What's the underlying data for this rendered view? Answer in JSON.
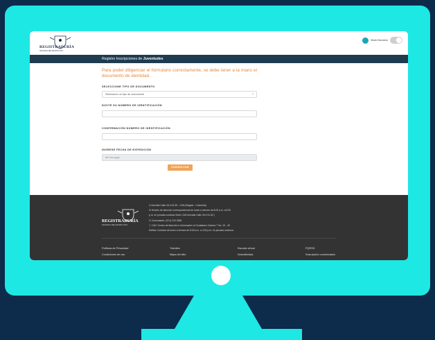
{
  "header": {
    "brand": "REGISTRADURÍA",
    "brand_sub": "NACIONAL DEL ESTADO CIVIL",
    "night_mode_label": "Modo Nocturno"
  },
  "title_bar": {
    "prefix": "Registro Inscripciones de ",
    "emphasis": "Juventudes"
  },
  "form": {
    "intro": "Para poder diligenciar el formulario correctamente, se debe tener a la mano el documento de identidad.",
    "doc_type_label": "SELECCIONE TIPO DE DOCUMENTO",
    "doc_type_value": "Seleccione un tipo de documento",
    "id_label": "DIGITE SU NÚMERO DE IDENTIFICACIÓN",
    "id_value": "",
    "confirm_label": "CONFIRMACIÓN NÚMERO DE IDENTIFICACIÓN",
    "confirm_value": "",
    "date_label": "INGRESE FECHA DE EXPEDICIÓN",
    "date_placeholder": "dd-mm-yyyy",
    "submit_label": "CONSULTAR"
  },
  "footer": {
    "brand": "REGISTRADURÍA",
    "brand_sub": "NACIONAL DEL ESTADO CIVIL",
    "info": [
      "Avenida Calle 26 # 51-50 - CAN (Bogotá - Colombia)",
      "Horario de atención correspondencia de lunes a viernes de 8:00 a.m. a 5:00",
      "p.m. en jornada continua Sede CAN Avenida Calle 26 # 51-50 |",
      "Conmutador: (571) 220 2880",
      "GAC Centro de Atención e Información al Ciudadano Carrera 7 No. 16 - 49",
      "Edificio Córdoba de lunes a viernes de 8:00 a.m. a 4:00 p.m. en jornada continua"
    ],
    "links": [
      [
        "Políticas de Privacidad",
        "Condiciones de uso"
      ],
      [
        "Trámites",
        "Mapa del sitio"
      ],
      [
        "Escuela virtual",
        "Normatividad"
      ],
      [
        "PQRSD",
        "Suscripción comunicados"
      ]
    ]
  },
  "colors": {
    "background": "#0d2b4a",
    "monitor": "#1ee8e3",
    "accent": "#e8863a",
    "title_bar": "#1f3b50",
    "footer": "#333333"
  }
}
